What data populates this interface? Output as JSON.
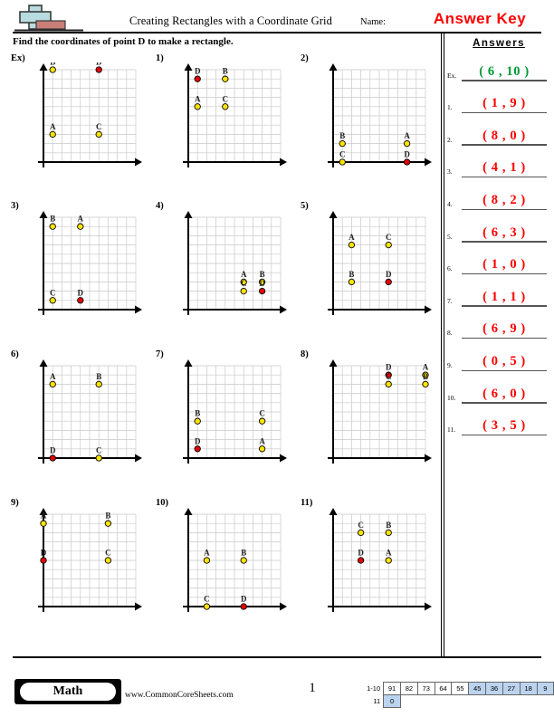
{
  "header": {
    "title": "Creating Rectangles with a Coordinate Grid",
    "name_label": "Name:",
    "answer_key": "Answer Key",
    "instructions": "Find the coordinates of point D to make a rectangle.",
    "logo_plus_color": "#b9dce0",
    "logo_bar_color": "#c97f77"
  },
  "answers_panel": {
    "title": "Answers",
    "rows": [
      {
        "num": "Ex.",
        "value": "( 6 , 10 )",
        "color": "#009933"
      },
      {
        "num": "1.",
        "value": "( 1 , 9 )",
        "color": "#ff0000"
      },
      {
        "num": "2.",
        "value": "( 8 , 0 )",
        "color": "#ff0000"
      },
      {
        "num": "3.",
        "value": "( 4 , 1 )",
        "color": "#ff0000"
      },
      {
        "num": "4.",
        "value": "( 8 , 2 )",
        "color": "#ff0000"
      },
      {
        "num": "5.",
        "value": "( 6 , 3 )",
        "color": "#ff0000"
      },
      {
        "num": "6.",
        "value": "( 1 , 0 )",
        "color": "#ff0000"
      },
      {
        "num": "7.",
        "value": "( 1 , 1 )",
        "color": "#ff0000"
      },
      {
        "num": "8.",
        "value": "( 6 , 9 )",
        "color": "#ff0000"
      },
      {
        "num": "9.",
        "value": "( 0 , 5 )",
        "color": "#ff0000"
      },
      {
        "num": "10.",
        "value": "( 6 , 0 )",
        "color": "#ff0000"
      },
      {
        "num": "11.",
        "value": "( 3 , 5 )",
        "color": "#ff0000"
      }
    ]
  },
  "chart_data": {
    "type": "scatter",
    "title": "Creating Rectangles with a Coordinate Grid",
    "xlabel": "",
    "ylabel": "",
    "xlim": [
      0,
      10
    ],
    "ylim": [
      0,
      10
    ],
    "grid": true,
    "legend": "none",
    "point_colors": {
      "given": "#ffe400",
      "answer": "#e60000"
    },
    "plots": [
      {
        "label": "Ex)",
        "points": [
          {
            "name": "A",
            "x": 1,
            "y": 3,
            "kind": "given"
          },
          {
            "name": "B",
            "x": 1,
            "y": 10,
            "kind": "given"
          },
          {
            "name": "C",
            "x": 6,
            "y": 3,
            "kind": "given"
          },
          {
            "name": "D",
            "x": 6,
            "y": 10,
            "kind": "answer"
          }
        ]
      },
      {
        "label": "1)",
        "points": [
          {
            "name": "D",
            "x": 1,
            "y": 9,
            "kind": "answer"
          },
          {
            "name": "B",
            "x": 4,
            "y": 9,
            "kind": "given"
          },
          {
            "name": "A",
            "x": 1,
            "y": 6,
            "kind": "given"
          },
          {
            "name": "C",
            "x": 4,
            "y": 6,
            "kind": "given"
          }
        ]
      },
      {
        "label": "2)",
        "points": [
          {
            "name": "B",
            "x": 1,
            "y": 2,
            "kind": "given"
          },
          {
            "name": "C",
            "x": 1,
            "y": 0,
            "kind": "given"
          },
          {
            "name": "A",
            "x": 8,
            "y": 2,
            "kind": "given"
          },
          {
            "name": "D",
            "x": 8,
            "y": 0,
            "kind": "answer"
          }
        ]
      },
      {
        "label": "3)",
        "points": [
          {
            "name": "B",
            "x": 1,
            "y": 9,
            "kind": "given"
          },
          {
            "name": "A",
            "x": 4,
            "y": 9,
            "kind": "given"
          },
          {
            "name": "C",
            "x": 1,
            "y": 1,
            "kind": "given"
          },
          {
            "name": "D",
            "x": 4,
            "y": 1,
            "kind": "answer"
          }
        ]
      },
      {
        "label": "4)",
        "points": [
          {
            "name": "A",
            "x": 6,
            "y": 3,
            "kind": "given"
          },
          {
            "name": "B",
            "x": 8,
            "y": 3,
            "kind": "given"
          },
          {
            "name": "C",
            "x": 6,
            "y": 2,
            "kind": "given"
          },
          {
            "name": "D",
            "x": 8,
            "y": 2,
            "kind": "answer"
          }
        ]
      },
      {
        "label": "5)",
        "points": [
          {
            "name": "A",
            "x": 2,
            "y": 7,
            "kind": "given"
          },
          {
            "name": "C",
            "x": 6,
            "y": 7,
            "kind": "given"
          },
          {
            "name": "B",
            "x": 2,
            "y": 3,
            "kind": "given"
          },
          {
            "name": "D",
            "x": 6,
            "y": 3,
            "kind": "answer"
          }
        ]
      },
      {
        "label": "6)",
        "points": [
          {
            "name": "A",
            "x": 1,
            "y": 8,
            "kind": "given"
          },
          {
            "name": "B",
            "x": 6,
            "y": 8,
            "kind": "given"
          },
          {
            "name": "D",
            "x": 1,
            "y": 0,
            "kind": "answer"
          },
          {
            "name": "C",
            "x": 6,
            "y": 0,
            "kind": "given"
          }
        ]
      },
      {
        "label": "7)",
        "points": [
          {
            "name": "B",
            "x": 1,
            "y": 4,
            "kind": "given"
          },
          {
            "name": "C",
            "x": 8,
            "y": 4,
            "kind": "given"
          },
          {
            "name": "D",
            "x": 1,
            "y": 1,
            "kind": "answer"
          },
          {
            "name": "A",
            "x": 8,
            "y": 1,
            "kind": "given"
          }
        ]
      },
      {
        "label": "8)",
        "points": [
          {
            "name": "D",
            "x": 6,
            "y": 9,
            "kind": "answer"
          },
          {
            "name": "A",
            "x": 10,
            "y": 9,
            "kind": "given"
          },
          {
            "name": "C",
            "x": 6,
            "y": 8,
            "kind": "given"
          },
          {
            "name": "B",
            "x": 10,
            "y": 8,
            "kind": "given"
          }
        ]
      },
      {
        "label": "9)",
        "points": [
          {
            "name": "A",
            "x": 0,
            "y": 9,
            "kind": "given"
          },
          {
            "name": "B",
            "x": 7,
            "y": 9,
            "kind": "given"
          },
          {
            "name": "D",
            "x": 0,
            "y": 5,
            "kind": "answer"
          },
          {
            "name": "C",
            "x": 7,
            "y": 5,
            "kind": "given"
          }
        ]
      },
      {
        "label": "10)",
        "points": [
          {
            "name": "A",
            "x": 2,
            "y": 5,
            "kind": "given"
          },
          {
            "name": "B",
            "x": 6,
            "y": 5,
            "kind": "given"
          },
          {
            "name": "C",
            "x": 2,
            "y": 0,
            "kind": "given"
          },
          {
            "name": "D",
            "x": 6,
            "y": 0,
            "kind": "answer"
          }
        ]
      },
      {
        "label": "11)",
        "points": [
          {
            "name": "C",
            "x": 3,
            "y": 8,
            "kind": "given"
          },
          {
            "name": "B",
            "x": 6,
            "y": 8,
            "kind": "given"
          },
          {
            "name": "D",
            "x": 3,
            "y": 5,
            "kind": "answer"
          },
          {
            "name": "A",
            "x": 6,
            "y": 5,
            "kind": "given"
          }
        ]
      }
    ]
  },
  "footer": {
    "subject_badge": "Math",
    "website": "www.CommonCoreSheets.com",
    "page_number": "1",
    "score_table": {
      "rows": [
        {
          "label": "1-10",
          "cells": [
            {
              "value": "91",
              "highlight": false
            },
            {
              "value": "82",
              "highlight": false
            },
            {
              "value": "73",
              "highlight": false
            },
            {
              "value": "64",
              "highlight": false
            },
            {
              "value": "55",
              "highlight": false
            },
            {
              "value": "45",
              "highlight": true
            },
            {
              "value": "36",
              "highlight": true
            },
            {
              "value": "27",
              "highlight": true
            },
            {
              "value": "18",
              "highlight": true
            },
            {
              "value": "9",
              "highlight": true
            }
          ]
        },
        {
          "label": "11",
          "cells": [
            {
              "value": "0",
              "highlight": true
            }
          ]
        }
      ]
    }
  }
}
